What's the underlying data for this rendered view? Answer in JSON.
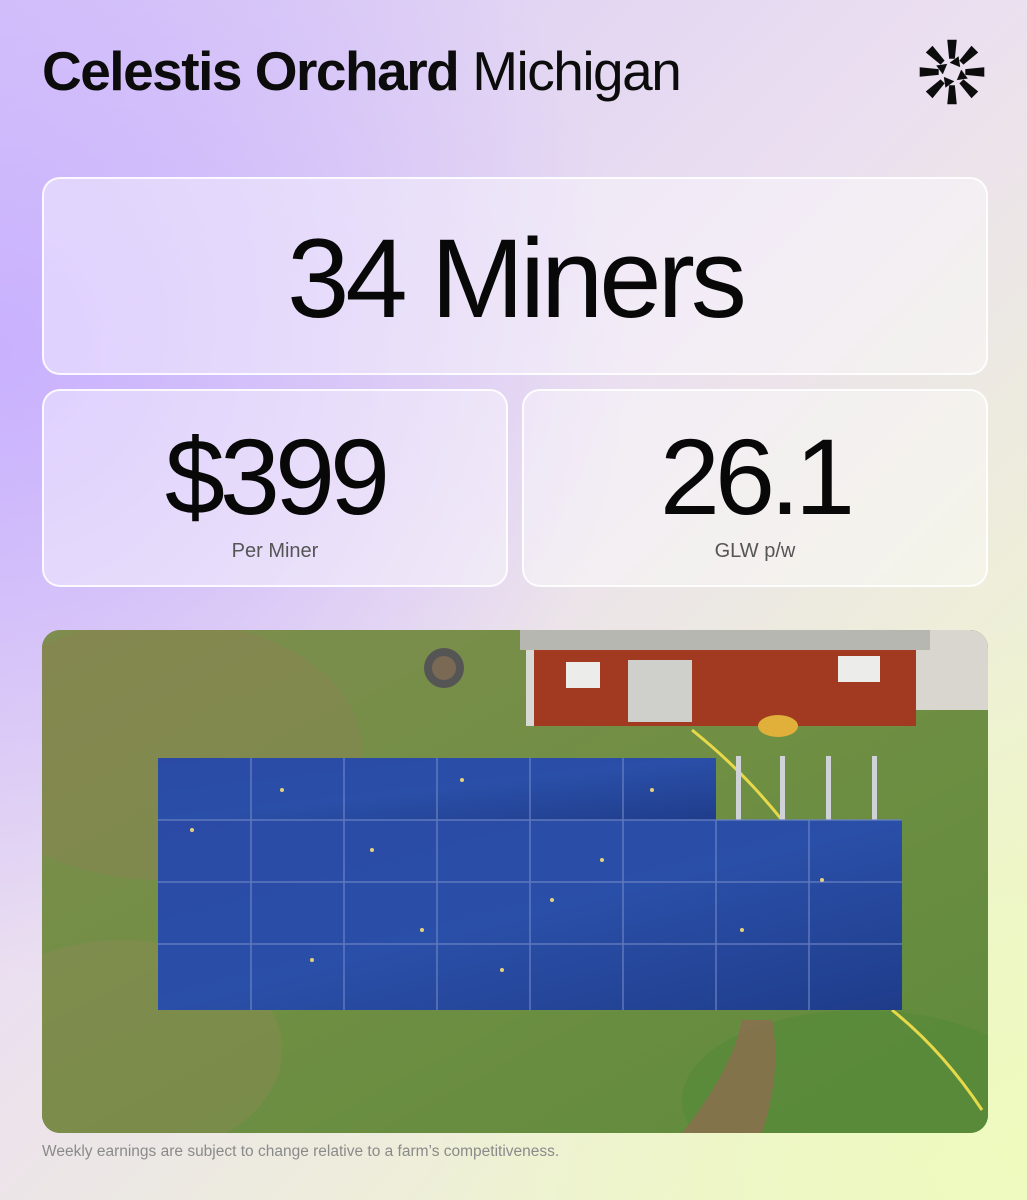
{
  "header": {
    "farm_name": "Celestis Orchard",
    "location": "Michigan",
    "logo_icon": "starburst-logo-icon"
  },
  "stats": {
    "miners": "34 Miners",
    "price_value": "$399",
    "price_label": "Per Miner",
    "glw_value": "26.1",
    "glw_label": "GLW p/w"
  },
  "photo": {
    "subject_icon": "solar-array-photo"
  },
  "footnote": "Weekly earnings are subject to change relative to a farm’s competitiveness.",
  "colors": {
    "text": "#0c0c0c",
    "muted": "#555555",
    "footnote": "#8a8a8a",
    "panel_blue": "#26459a",
    "barn_red": "#a23a22"
  }
}
